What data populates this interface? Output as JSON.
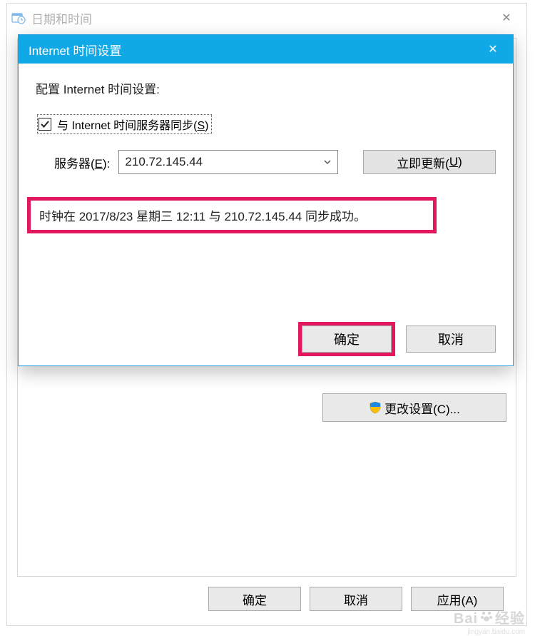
{
  "outerWindow": {
    "title": "日期和时间",
    "closeGlyph": "✕",
    "changeSettingsLabel": "更改设置(C)...",
    "okLabel": "确定",
    "cancelLabel": "取消",
    "applyLabel": "应用(A)"
  },
  "innerDialog": {
    "title": "Internet 时间设置",
    "closeGlyph": "✕",
    "configHeading": "配置 Internet 时间设置:",
    "syncCheckboxLabel_pre": "与 Internet 时间服务器同步(",
    "syncCheckboxLabel_key": "S",
    "syncCheckboxLabel_post": ")",
    "syncChecked": true,
    "serverLabel_pre": "服务器(",
    "serverLabel_key": "E",
    "serverLabel_post": "):",
    "serverValue": "210.72.145.44",
    "updateNowLabel_pre": "立即更新(",
    "updateNowLabel_key": "U",
    "updateNowLabel_post": ")",
    "statusText": "时钟在 2017/8/23 星期三 12:11 与 210.72.145.44 同步成功。",
    "okLabel": "确定",
    "cancelLabel": "取消"
  },
  "watermark": {
    "brand": "Bai",
    "brandSuffix": "经验",
    "url": "jingyan.baidu.com"
  },
  "colors": {
    "titlebarActive": "#10a8e6",
    "highlightBorder": "#e2175f"
  }
}
